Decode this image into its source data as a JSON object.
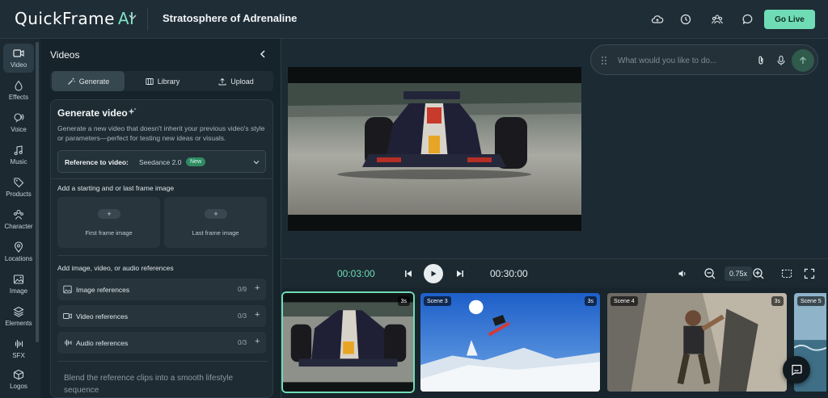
{
  "app": {
    "logo_main": "QuickFrame",
    "logo_accent": "AI",
    "project_title": "Stratosphere of Adrenaline",
    "go_live_label": "Go Live"
  },
  "top_icons": [
    "cloud-upload-icon",
    "history-icon",
    "collaborators-icon",
    "chat-icon"
  ],
  "rail": {
    "items": [
      {
        "label": "Video",
        "icon": "video-icon",
        "active": true
      },
      {
        "label": "Effects",
        "icon": "effects-icon"
      },
      {
        "label": "Voice",
        "icon": "voice-icon"
      },
      {
        "label": "Music",
        "icon": "music-icon"
      },
      {
        "label": "Products",
        "icon": "tag-icon"
      },
      {
        "label": "Character",
        "icon": "character-icon"
      },
      {
        "label": "Locations",
        "icon": "location-pin-icon"
      },
      {
        "label": "Image",
        "icon": "image-icon"
      },
      {
        "label": "Elements",
        "icon": "elements-icon"
      },
      {
        "label": "SFX",
        "icon": "waveform-icon"
      },
      {
        "label": "Logos",
        "icon": "cube-icon"
      }
    ]
  },
  "panel": {
    "title": "Videos",
    "tabs": [
      {
        "label": "Generate",
        "active": true
      },
      {
        "label": "Library"
      },
      {
        "label": "Upload"
      }
    ],
    "generate": {
      "title": "Generate video",
      "description": "Generate a new video that doesn't inherit your previous video's style or parameters—perfect for testing new ideas or visuals.",
      "reference_label": "Reference to video:",
      "reference_value": "Seedance 2.0",
      "reference_badge": "New",
      "frames_heading": "Add a starting and or last frame image",
      "first_frame": "First frame image",
      "last_frame": "Last frame image",
      "frame_plus": "+",
      "refs_heading": "Add image, video, or audio references",
      "references": [
        {
          "label": "Image references",
          "count": "0/9",
          "icon": "image-icon"
        },
        {
          "label": "Video references",
          "count": "0/3",
          "icon": "video-icon"
        },
        {
          "label": "Audio references",
          "count": "0/3",
          "icon": "waveform-icon"
        }
      ],
      "plus": "+",
      "prompt_text": "Blend the reference clips into a smooth lifestyle sequence"
    }
  },
  "chat": {
    "placeholder": "What would you like to do..."
  },
  "transport": {
    "current_time": "00:03:00",
    "total_time": "00:30:00",
    "zoom": "0.75x"
  },
  "timeline": {
    "clips": [
      {
        "scene": "",
        "duration": "3s",
        "selected": true,
        "art": "racecar"
      },
      {
        "scene": "Scene 3",
        "duration": "3s",
        "art": "snowboard"
      },
      {
        "scene": "Scene 4",
        "duration": "3s",
        "art": "climber"
      },
      {
        "scene": "Scene 5",
        "duration": "",
        "art": "sea"
      }
    ]
  },
  "colors": {
    "accent": "#6fdcb5",
    "background": "#1b2a33",
    "panel": "#17232b"
  }
}
